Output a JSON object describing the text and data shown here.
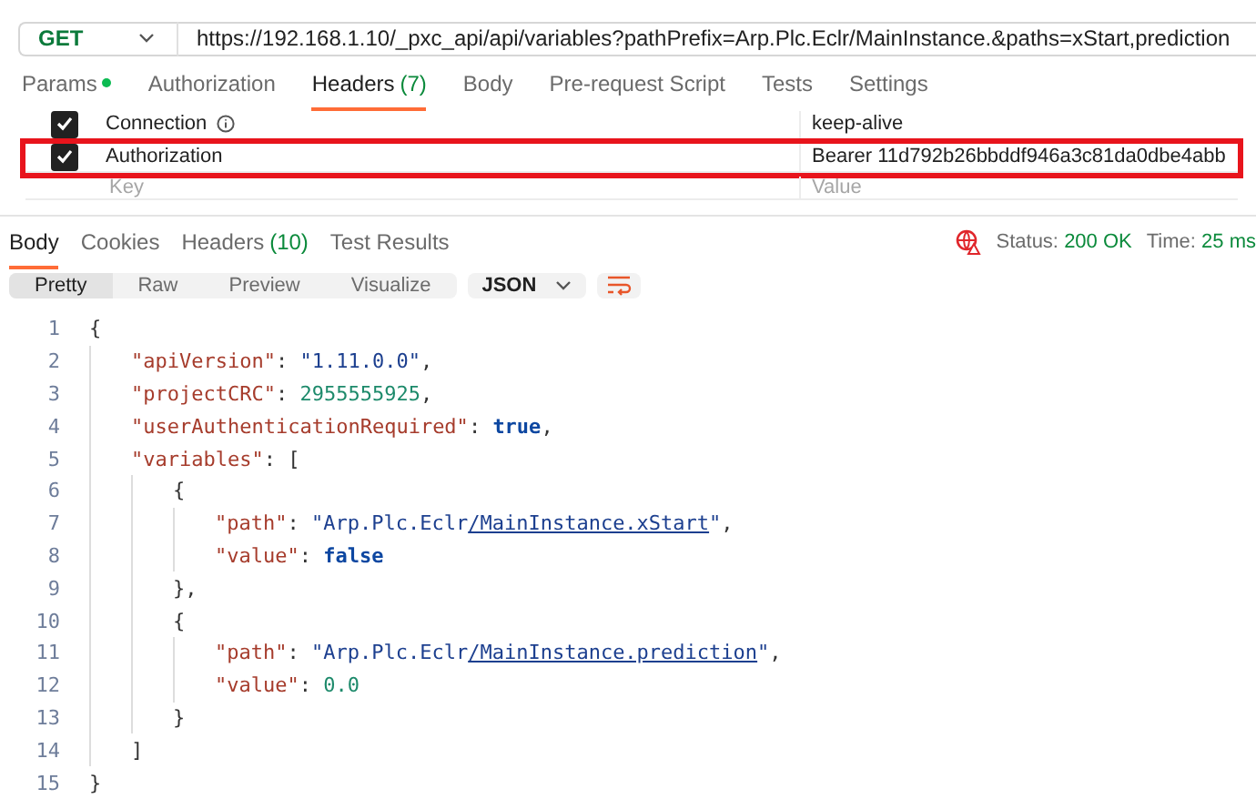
{
  "request": {
    "method": "GET",
    "url": "https://192.168.1.10/_pxc_api/api/variables?pathPrefix=Arp.Plc.Eclr/MainInstance.&paths=xStart,prediction"
  },
  "request_tabs": [
    {
      "label": "Params",
      "dot": true,
      "selected": false
    },
    {
      "label": "Authorization",
      "dot": false,
      "selected": false
    },
    {
      "label": "Headers",
      "count": "(7)",
      "dot": false,
      "selected": true
    },
    {
      "label": "Body",
      "dot": false,
      "selected": false
    },
    {
      "label": "Pre-request Script",
      "dot": false,
      "selected": false
    },
    {
      "label": "Tests",
      "dot": false,
      "selected": false
    },
    {
      "label": "Settings",
      "dot": false,
      "selected": false
    }
  ],
  "headers": [
    {
      "key": "Connection",
      "value": "keep-alive",
      "checked": true,
      "info": true,
      "highlighted": false
    },
    {
      "key": "Authorization",
      "value": "Bearer 11d792b26bbddf946a3c81da0dbe4abb",
      "checked": true,
      "info": false,
      "highlighted": true
    }
  ],
  "new_header": {
    "key_placeholder": "Key",
    "value_placeholder": "Value"
  },
  "response_tabs": [
    {
      "label": "Body",
      "selected": true
    },
    {
      "label": "Cookies",
      "selected": false
    },
    {
      "label": "Headers",
      "count": "(10)",
      "selected": false
    },
    {
      "label": "Test Results",
      "selected": false
    }
  ],
  "status": {
    "status_label": "Status:",
    "status_value": "200 OK",
    "time_label": "Time:",
    "time_value": "25 ms"
  },
  "view_modes": [
    {
      "label": "Pretty",
      "selected": true
    },
    {
      "label": "Raw",
      "selected": false
    },
    {
      "label": "Preview",
      "selected": false
    },
    {
      "label": "Visualize",
      "selected": false
    }
  ],
  "format": "JSON",
  "code_lines": [
    {
      "number": "1",
      "tokens": [
        {
          "kind": "punct",
          "text": "{"
        }
      ]
    },
    {
      "number": "2",
      "tokens": [
        {
          "kind": "key",
          "text": "\"apiVersion\""
        },
        {
          "kind": "punct",
          "text": ": "
        },
        {
          "kind": "string",
          "text": "\"1.11.0.0\""
        },
        {
          "kind": "punct",
          "text": ","
        }
      ]
    },
    {
      "number": "3",
      "tokens": [
        {
          "kind": "key",
          "text": "\"projectCRC\""
        },
        {
          "kind": "punct",
          "text": ": "
        },
        {
          "kind": "number",
          "text": "2955555925"
        },
        {
          "kind": "punct",
          "text": ","
        }
      ]
    },
    {
      "number": "4",
      "tokens": [
        {
          "kind": "key",
          "text": "\"userAuthenticationRequired\""
        },
        {
          "kind": "punct",
          "text": ": "
        },
        {
          "kind": "bool",
          "text": "true"
        },
        {
          "kind": "punct",
          "text": ","
        }
      ]
    },
    {
      "number": "5",
      "tokens": [
        {
          "kind": "key",
          "text": "\"variables\""
        },
        {
          "kind": "punct",
          "text": ": ["
        }
      ]
    },
    {
      "number": "6",
      "tokens": [
        {
          "kind": "punct",
          "text": "{"
        }
      ]
    },
    {
      "number": "7",
      "tokens": [
        {
          "kind": "key",
          "text": "\"path\""
        },
        {
          "kind": "punct",
          "text": ": "
        },
        {
          "kind": "string",
          "text": "\"Arp.Plc.Eclr"
        },
        {
          "kind": "link",
          "text": "/MainInstance.xStart"
        },
        {
          "kind": "string",
          "text": "\""
        },
        {
          "kind": "punct",
          "text": ","
        }
      ]
    },
    {
      "number": "8",
      "tokens": [
        {
          "kind": "key",
          "text": "\"value\""
        },
        {
          "kind": "punct",
          "text": ": "
        },
        {
          "kind": "bool",
          "text": "false"
        }
      ]
    },
    {
      "number": "9",
      "tokens": [
        {
          "kind": "punct",
          "text": "},"
        }
      ]
    },
    {
      "number": "10",
      "tokens": [
        {
          "kind": "punct",
          "text": "{"
        }
      ]
    },
    {
      "number": "11",
      "tokens": [
        {
          "kind": "key",
          "text": "\"path\""
        },
        {
          "kind": "punct",
          "text": ": "
        },
        {
          "kind": "string",
          "text": "\"Arp.Plc.Eclr"
        },
        {
          "kind": "link",
          "text": "/MainInstance.prediction"
        },
        {
          "kind": "string",
          "text": "\""
        },
        {
          "kind": "punct",
          "text": ","
        }
      ]
    },
    {
      "number": "12",
      "tokens": [
        {
          "kind": "key",
          "text": "\"value\""
        },
        {
          "kind": "punct",
          "text": ": "
        },
        {
          "kind": "number",
          "text": "0.0"
        }
      ]
    },
    {
      "number": "13",
      "tokens": [
        {
          "kind": "punct",
          "text": "}"
        }
      ]
    },
    {
      "number": "14",
      "tokens": [
        {
          "kind": "punct",
          "text": "]"
        }
      ]
    },
    {
      "number": "15",
      "tokens": [
        {
          "kind": "punct",
          "text": "}"
        }
      ]
    }
  ]
}
